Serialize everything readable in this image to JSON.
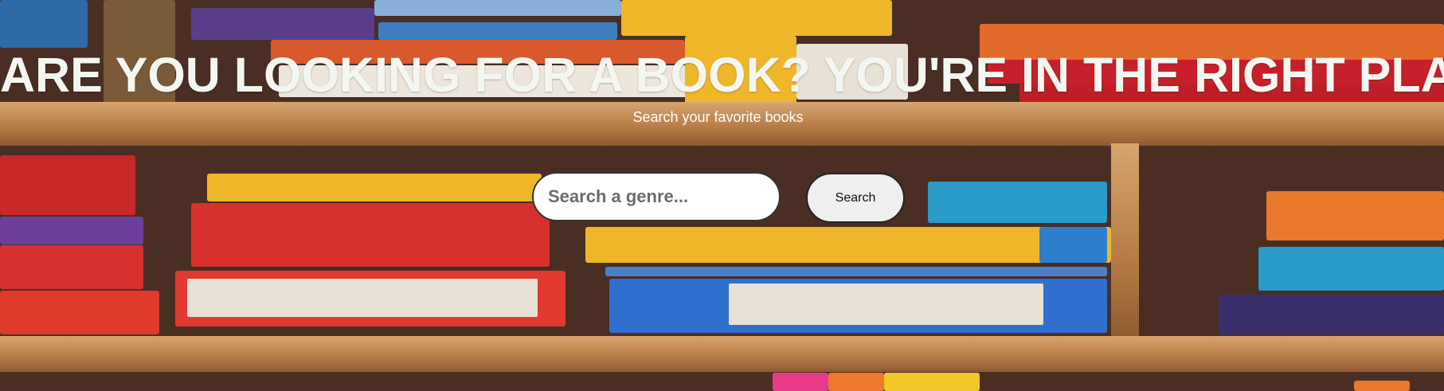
{
  "hero": {
    "headline": "ARE YOU LOOKING FOR A BOOK? YOU'RE IN THE RIGHT PLACE !",
    "subtitle": "Search your favorite books"
  },
  "search": {
    "placeholder": "Search a genre...",
    "value": "",
    "button_label": "Search"
  },
  "colors": {
    "headline": "#f4f7f1",
    "shelf_wood": "#c8915a",
    "button_bg": "#efefef"
  }
}
